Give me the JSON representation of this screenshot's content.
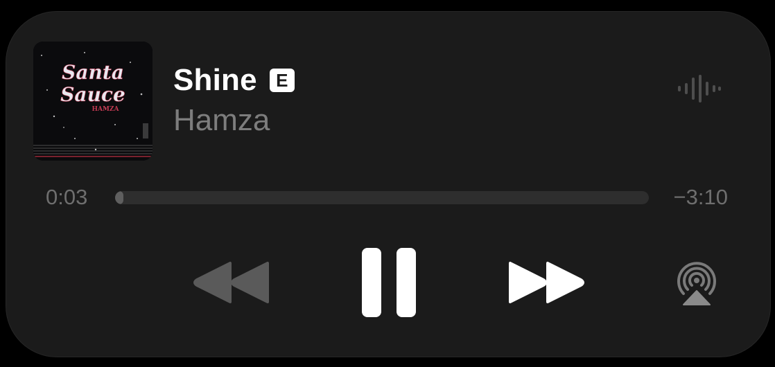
{
  "now_playing": {
    "title": "Shine",
    "explicit_badge": "E",
    "artist": "Hamza",
    "artwork": {
      "text_line1": "Santa",
      "text_line2": "Sauce",
      "text_line3": "HAMZA"
    }
  },
  "progress": {
    "elapsed": "0:03",
    "remaining": "−3:10",
    "fraction": 0.015
  },
  "controls": {
    "rewind_icon": "rewind-icon",
    "pause_icon": "pause-icon",
    "forward_icon": "fast-forward-icon",
    "airplay_icon": "airplay-audio-icon",
    "waveform_icon": "waveform-icon"
  },
  "colors": {
    "card_background": "#1b1b1b",
    "title": "#ffffff",
    "artist": "#7d7d7d",
    "time_text": "#6e6e6e",
    "track": "#2e2e2e",
    "disabled_control": "#5a5a5a"
  }
}
